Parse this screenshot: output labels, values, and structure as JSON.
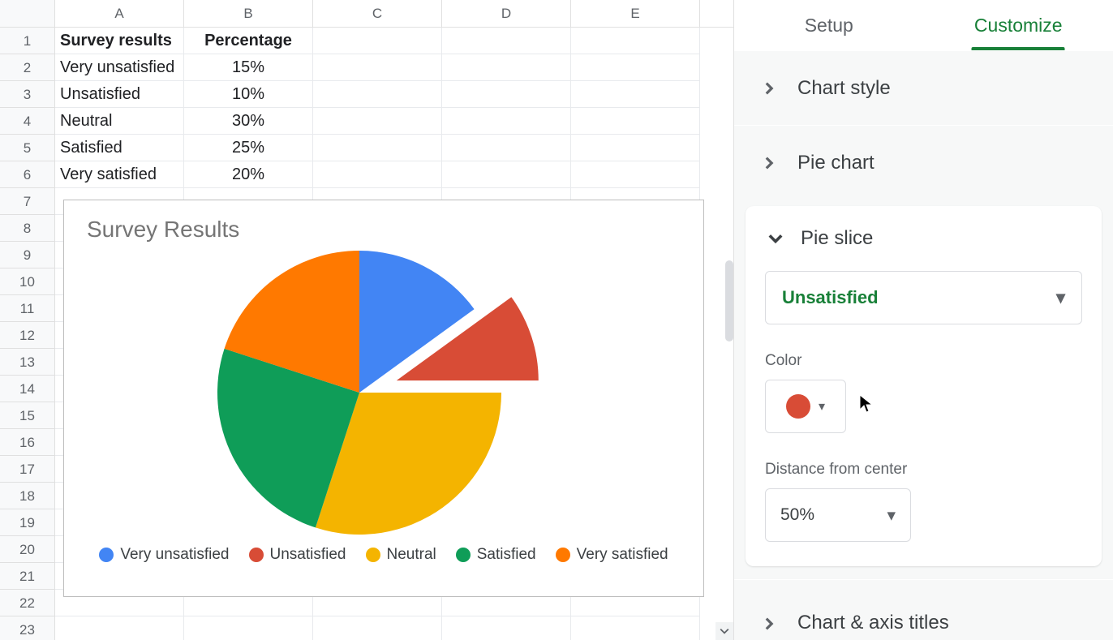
{
  "sheet": {
    "columns": [
      "A",
      "B",
      "C",
      "D",
      "E"
    ],
    "row_numbers": [
      1,
      2,
      3,
      4,
      5,
      6,
      7,
      8,
      9,
      10,
      11,
      12,
      13,
      14,
      15,
      16,
      17,
      18,
      19,
      20,
      21,
      22,
      23
    ],
    "headers": {
      "a": "Survey results",
      "b": "Percentage"
    },
    "rows": [
      {
        "a": "Very unsatisfied",
        "b": "15%"
      },
      {
        "a": "Unsatisfied",
        "b": "10%"
      },
      {
        "a": "Neutral",
        "b": "30%"
      },
      {
        "a": "Satisfied",
        "b": "25%"
      },
      {
        "a": "Very satisfied",
        "b": "20%"
      }
    ]
  },
  "chart_data": {
    "type": "pie",
    "title": "Survey Results",
    "categories": [
      "Very unsatisfied",
      "Unsatisfied",
      "Neutral",
      "Satisfied",
      "Very satisfied"
    ],
    "values": [
      15,
      10,
      30,
      25,
      20
    ],
    "colors": [
      "#4285f4",
      "#d84c36",
      "#f4b400",
      "#0f9d58",
      "#ff7900"
    ],
    "exploded": {
      "index": 1,
      "distance_pct": 50
    },
    "legend_position": "bottom"
  },
  "panel": {
    "tabs": {
      "setup": "Setup",
      "customize": "Customize"
    },
    "sections": {
      "chart_style": "Chart style",
      "pie_chart": "Pie chart",
      "pie_slice": "Pie slice",
      "chart_axis_titles": "Chart & axis titles"
    },
    "pie_slice": {
      "slice_selected": "Unsatisfied",
      "color_label": "Color",
      "color_value": "#d84c36",
      "distance_label": "Distance from center",
      "distance_value": "50%"
    }
  }
}
